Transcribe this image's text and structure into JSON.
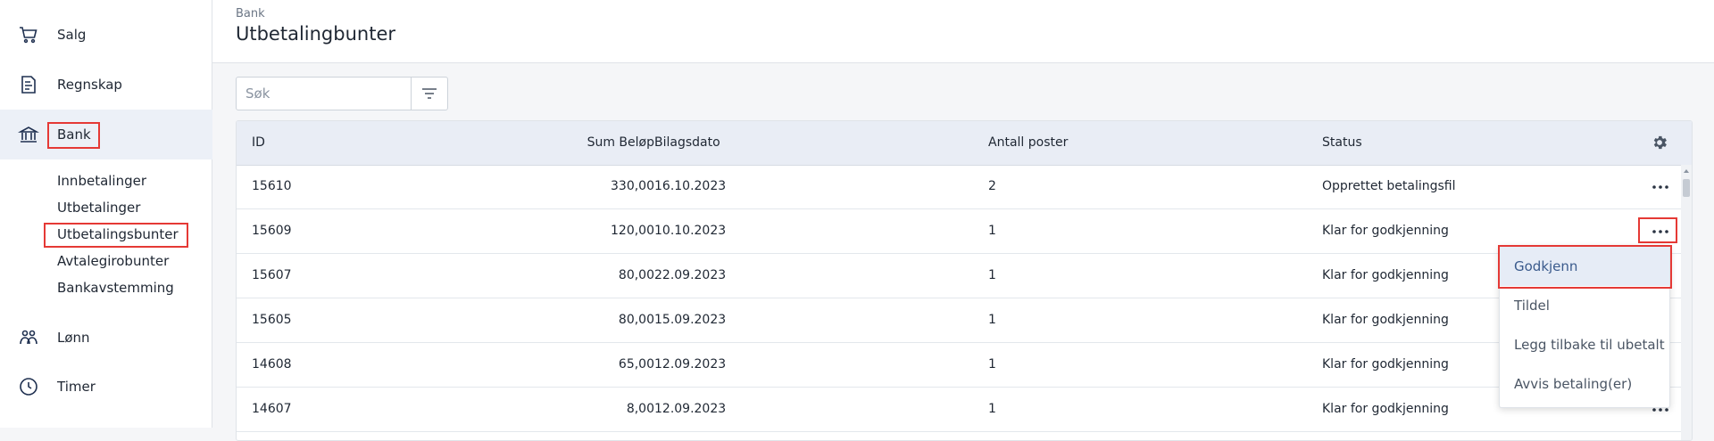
{
  "sidebar": {
    "items": [
      {
        "label": "Salg",
        "icon": "cart-icon"
      },
      {
        "label": "Regnskap",
        "icon": "ledger-icon"
      },
      {
        "label": "Bank",
        "icon": "bank-icon",
        "active": true
      },
      {
        "label": "Lønn",
        "icon": "people-icon"
      },
      {
        "label": "Timer",
        "icon": "clock-icon"
      }
    ],
    "bank_sub": [
      {
        "label": "Innbetalinger"
      },
      {
        "label": "Utbetalinger"
      },
      {
        "label": "Utbetalingsbunter",
        "selected": true
      },
      {
        "label": "Avtalegirobunter"
      },
      {
        "label": "Bankavstemming"
      }
    ]
  },
  "header": {
    "breadcrumb": "Bank",
    "title": "Utbetalingbunter"
  },
  "search": {
    "placeholder": "Søk",
    "value": ""
  },
  "table": {
    "columns": [
      "ID",
      "Sum Beløp",
      "Bilagsdato",
      "Antall poster",
      "Status"
    ],
    "rows": [
      {
        "id": "15610",
        "sum": "330,00",
        "date": "16.10.2023",
        "count": "2",
        "status": "Opprettet betalingsfil"
      },
      {
        "id": "15609",
        "sum": "120,00",
        "date": "10.10.2023",
        "count": "1",
        "status": "Klar for godkjenning"
      },
      {
        "id": "15607",
        "sum": "80,00",
        "date": "22.09.2023",
        "count": "1",
        "status": "Klar for godkjenning"
      },
      {
        "id": "15605",
        "sum": "80,00",
        "date": "15.09.2023",
        "count": "1",
        "status": "Klar for godkjenning"
      },
      {
        "id": "14608",
        "sum": "65,00",
        "date": "12.09.2023",
        "count": "1",
        "status": "Klar for godkjenning"
      },
      {
        "id": "14607",
        "sum": "8,00",
        "date": "12.09.2023",
        "count": "1",
        "status": "Klar for godkjenning"
      }
    ]
  },
  "context_menu": {
    "items": [
      {
        "label": "Godkjenn"
      },
      {
        "label": "Tildel"
      },
      {
        "label": "Legg tilbake til ubetalt"
      },
      {
        "label": "Avvis betaling(er)"
      }
    ]
  },
  "colors": {
    "highlight": "#e53935",
    "active_nav": "#ecf0f7",
    "table_header": "#e9edf5",
    "menu_active": "#e6ecf6"
  }
}
